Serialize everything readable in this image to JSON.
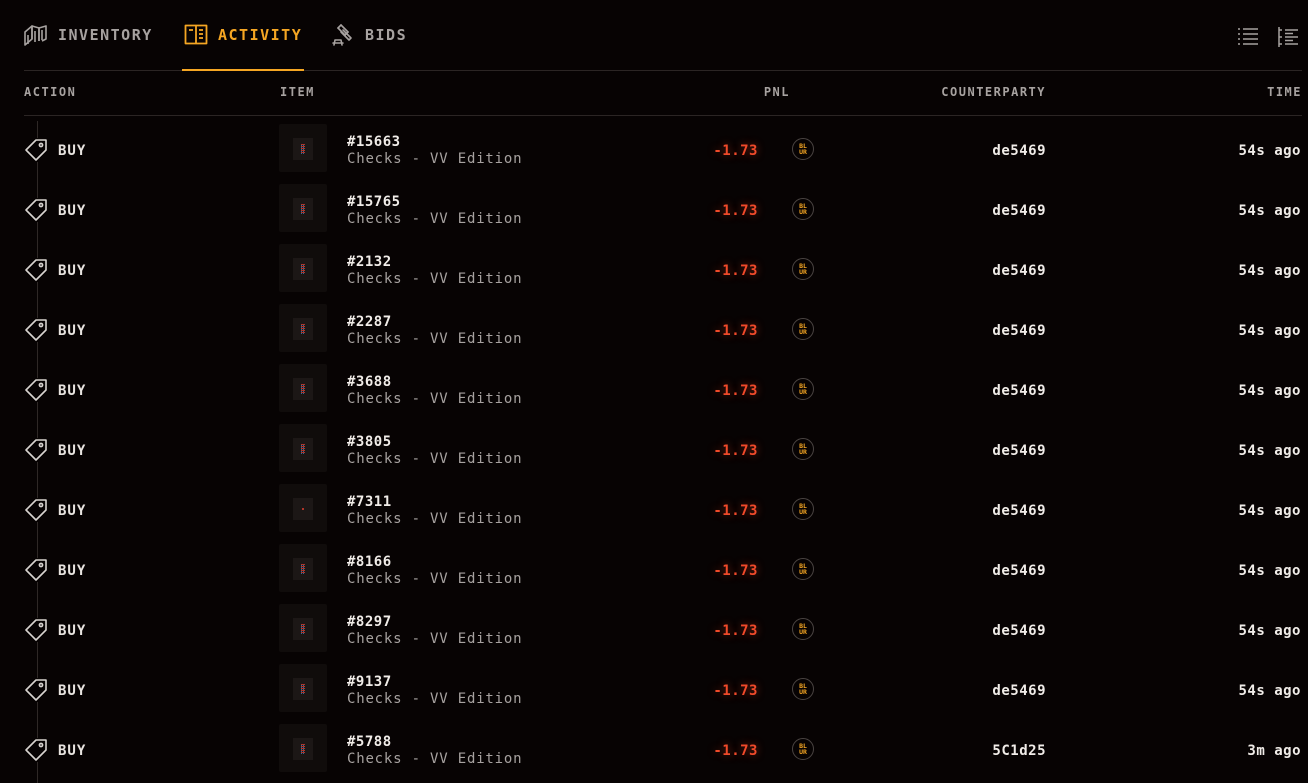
{
  "tabs": [
    {
      "key": "inventory",
      "label": "INVENTORY",
      "active": false,
      "icon": "stack-icon"
    },
    {
      "key": "activity",
      "label": "ACTIVITY",
      "active": true,
      "icon": "book-icon"
    },
    {
      "key": "bids",
      "label": "BIDS",
      "active": false,
      "icon": "gavel-icon"
    }
  ],
  "view_toggles": [
    "list-view-icon",
    "detailed-list-icon"
  ],
  "colors": {
    "accent": "#f5a623",
    "pnl_negative": "#f04a2a",
    "background": "#070303",
    "muted": "#a7a2a0"
  },
  "table": {
    "columns": {
      "action": "ACTION",
      "item": "ITEM",
      "pnl": "PNL",
      "counterparty": "COUNTERPARTY",
      "time": "TIME"
    },
    "token_label": "BL UR",
    "rows": [
      {
        "action": "BUY",
        "id": "#15663",
        "name": "Checks - VV Edition",
        "pnl": "-1.73",
        "counterparty": "de5469",
        "time": "54s ago"
      },
      {
        "action": "BUY",
        "id": "#15765",
        "name": "Checks - VV Edition",
        "pnl": "-1.73",
        "counterparty": "de5469",
        "time": "54s ago"
      },
      {
        "action": "BUY",
        "id": "#2132",
        "name": "Checks - VV Edition",
        "pnl": "-1.73",
        "counterparty": "de5469",
        "time": "54s ago"
      },
      {
        "action": "BUY",
        "id": "#2287",
        "name": "Checks - VV Edition",
        "pnl": "-1.73",
        "counterparty": "de5469",
        "time": "54s ago"
      },
      {
        "action": "BUY",
        "id": "#3688",
        "name": "Checks - VV Edition",
        "pnl": "-1.73",
        "counterparty": "de5469",
        "time": "54s ago"
      },
      {
        "action": "BUY",
        "id": "#3805",
        "name": "Checks - VV Edition",
        "pnl": "-1.73",
        "counterparty": "de5469",
        "time": "54s ago"
      },
      {
        "action": "BUY",
        "id": "#7311",
        "name": "Checks - VV Edition",
        "pnl": "-1.73",
        "counterparty": "de5469",
        "time": "54s ago"
      },
      {
        "action": "BUY",
        "id": "#8166",
        "name": "Checks - VV Edition",
        "pnl": "-1.73",
        "counterparty": "de5469",
        "time": "54s ago"
      },
      {
        "action": "BUY",
        "id": "#8297",
        "name": "Checks - VV Edition",
        "pnl": "-1.73",
        "counterparty": "de5469",
        "time": "54s ago"
      },
      {
        "action": "BUY",
        "id": "#9137",
        "name": "Checks - VV Edition",
        "pnl": "-1.73",
        "counterparty": "de5469",
        "time": "54s ago"
      },
      {
        "action": "BUY",
        "id": "#5788",
        "name": "Checks - VV Edition",
        "pnl": "-1.73",
        "counterparty": "5C1d25",
        "time": "3m ago"
      }
    ]
  }
}
